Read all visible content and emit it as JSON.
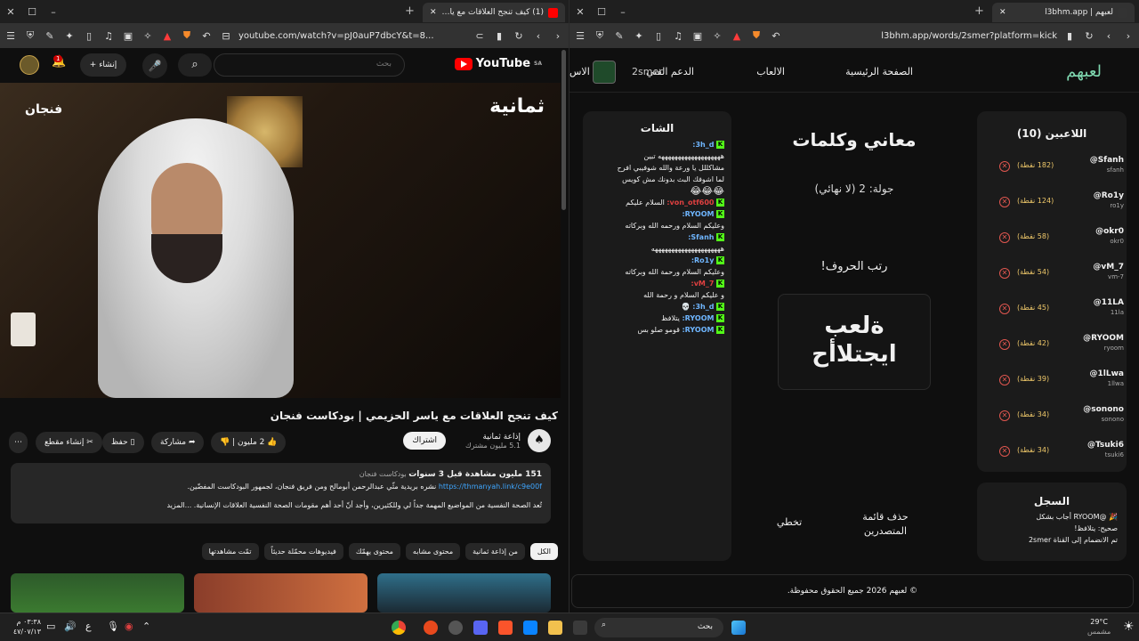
{
  "left_window": {
    "tab_title": "(1) كيف تنجح العلاقات مع ياسر الحز",
    "url": "youtube.com/watch?v=pJ0auP7dbcY&t=8..."
  },
  "youtube": {
    "logo": "YouTube",
    "region": "SA",
    "search_placeholder": "بحث",
    "create_label": "إنشاء",
    "notif_count": "1",
    "video_brand_right": "ثمانية",
    "video_brand_left": "فنجان",
    "video_title": "كيف تنجح العلاقات مع ياسر الحزيمي | بودكاست فنجان",
    "channel_name": "إذاعة ثمانية",
    "channel_subs": "5.1 مليون مشترك",
    "subscribe": "اشتراك",
    "likes": "2 مليون",
    "share": "مشاركة",
    "save": "حفظ",
    "clip": "إنشاء مقطع",
    "desc_stats": "151 مليون مشاهدة  قبل 3 سنوات",
    "desc_tag": "بودكاست فنجان",
    "desc_link": "https://thmanyah.link/c9e00f",
    "desc_line1_suffix": "نشره بريدية مثّي عبدالرحمن أبومالح ومن فريق فنجان، لجمهور البودكاست المفضّين.",
    "desc_line2": "تُعد الصحة النفسية من المواضيع المهمة جداً لي وللكثيرين، وأجد أنّ أحد أهم مقومات الصحة النفسية العلاقات الإنسانية. ...المزيد",
    "chips": [
      "الكل",
      "من إذاعة ثمانية",
      "محتوى مشابه",
      "محتوى يهمّك",
      "فيديوهات محمّلة حديثاً",
      "تمّت مشاهدتها"
    ]
  },
  "right_window": {
    "tab_title": "لعبهم | l3bhm.app",
    "url": "l3bhm.app/words/2smer?platform=kick"
  },
  "l3bhm": {
    "brand": "لعبهم",
    "nav": [
      "الصفحة الرئيسية",
      "الالعاب",
      "الدعم الفني"
    ],
    "nav_extra": "الاس",
    "user": "2smer",
    "players_title": "اللاعبين (10)",
    "players": [
      {
        "name": "@Sfanh",
        "user": "sfanh",
        "points": "(182 نقطة)"
      },
      {
        "name": "@Ro1y",
        "user": "ro1y",
        "points": "(124 نقطة)"
      },
      {
        "name": "@okr0",
        "user": "okr0",
        "points": "(58 نقطة)"
      },
      {
        "name": "@vM_7",
        "user": "vm-7",
        "points": "(54 نقطة)"
      },
      {
        "name": "@11LA",
        "user": "11la",
        "points": "(45 نقطة)"
      },
      {
        "name": "@RYOOM",
        "user": "ryoom",
        "points": "(42 نقطة)"
      },
      {
        "name": "@1lLwa",
        "user": "1llwa",
        "points": "(39 نقطة)"
      },
      {
        "name": "@sonono",
        "user": "sonono",
        "points": "(34 نقطة)"
      },
      {
        "name": "@Tsuki6",
        "user": "tsuki6",
        "points": "(34 نقطة)"
      }
    ],
    "log_title": "السجل",
    "log_lines": [
      "🎉 @RYOOM أجاب بشكل",
      "صحيح: يتلافظ!",
      "تم الانضمام إلى القناة 2smer"
    ],
    "game_title": "معاني وكلمات",
    "round": "جولة: 2 (لا نهائي)",
    "instruction": "رتب الحروف!",
    "scramble1": "ةلعب",
    "scramble2": "ايجتلاأح",
    "skip": "تخطي",
    "remove_leaders": "حذف قائمة المتصدرين",
    "chat_title": "الشات",
    "chat": [
      {
        "user": "3h_d:",
        "color": "#6fb6ff",
        "text": ""
      },
      {
        "user": "",
        "color": "",
        "text": "هههههههههههههههههههه تبين"
      },
      {
        "user": "",
        "color": "",
        "text": "مشاكللل يا ورعة والله شوفيبي افرح"
      },
      {
        "user": "",
        "color": "",
        "text": "لما اشوفك البث بدونك مش كويس"
      },
      {
        "user": "",
        "color": "",
        "text": "😂😂😂"
      },
      {
        "user": "von_otf600:",
        "color": "#e04040",
        "text": "السلام عليكم"
      },
      {
        "user": "RYOOM:",
        "color": "#6fb6ff",
        "text": ""
      },
      {
        "user": "",
        "color": "",
        "text": "وعليكم السلام ورحمه الله وبركاته"
      },
      {
        "user": "Sfanh:",
        "color": "#6fb6ff",
        "text": ""
      },
      {
        "user": "",
        "color": "",
        "text": "هههههههههههههههههههههه"
      },
      {
        "user": "Ro1y:",
        "color": "#6fb6ff",
        "text": ""
      },
      {
        "user": "",
        "color": "",
        "text": "وعليكم السلام ورحمة الله وبركاته"
      },
      {
        "user": "vM_7:",
        "color": "#e04040",
        "text": ""
      },
      {
        "user": "",
        "color": "",
        "text": "و عليكم السلام و رحمة الله"
      },
      {
        "user": "3h_d:",
        "color": "#6fb6ff",
        "text": "💀"
      },
      {
        "user": "RYOOM:",
        "color": "#6fb6ff",
        "text": "يتلافظ"
      },
      {
        "user": "RYOOM:",
        "color": "#6fb6ff",
        "text": "قومو صلو بس"
      }
    ],
    "footer": "© لعبهم 2026 جميع الحقوق محفوظة."
  },
  "taskbar": {
    "time": "٠٣:٣٨ م",
    "date": "٤٧/٠٧/١٣",
    "search_placeholder": "بحث",
    "weather_temp": "29°C",
    "weather_desc": "مشمس",
    "lang": "ع"
  },
  "colors": {
    "yt_red": "#ff0000",
    "kick_green": "#53fc18",
    "brand_teal": "#7fd8b0",
    "points": "#f0c96a"
  }
}
